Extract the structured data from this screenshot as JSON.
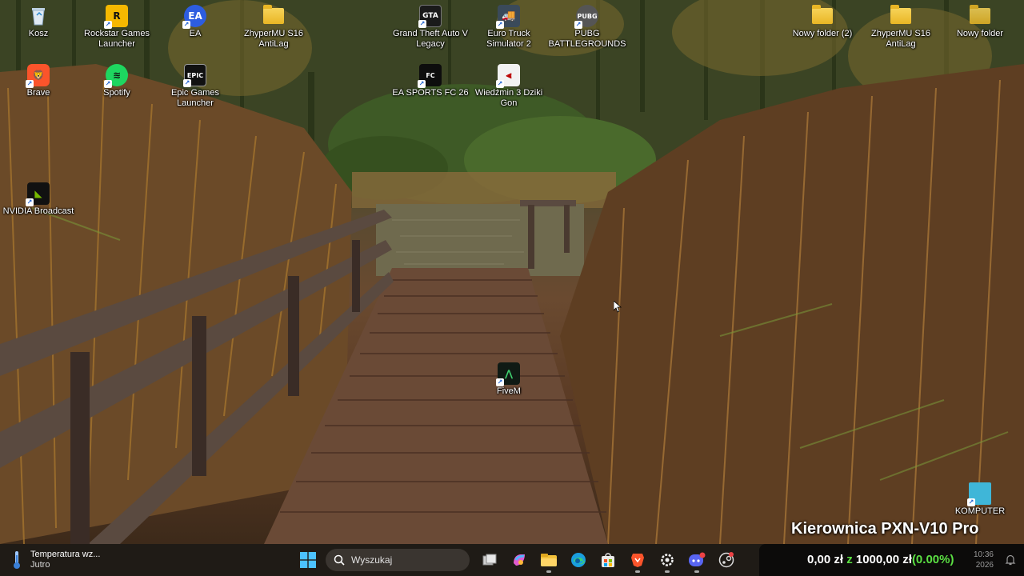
{
  "desktop": {
    "icons": [
      {
        "label": "Kosz",
        "icon": "recycle-bin-icon"
      },
      {
        "label": "Rockstar Games Launcher",
        "icon": "rockstar-icon"
      },
      {
        "label": "EA",
        "icon": "ea-icon"
      },
      {
        "label": "ZhyperMU S16 AntiLag",
        "icon": "folder-icon"
      },
      {
        "label": "Grand Theft Auto V Legacy",
        "icon": "gta-icon"
      },
      {
        "label": "Euro Truck Simulator 2",
        "icon": "truck-icon"
      },
      {
        "label": "PUBG BATTLEGROUNDS",
        "icon": "pubg-icon"
      },
      {
        "label": "Nowy folder (2)",
        "icon": "folder-icon"
      },
      {
        "label": "ZhyperMU S16 AntiLag",
        "icon": "folder-icon"
      },
      {
        "label": "Nowy folder",
        "icon": "folder-icon"
      },
      {
        "label": "Brave",
        "icon": "brave-icon"
      },
      {
        "label": "Spotify",
        "icon": "spotify-icon"
      },
      {
        "label": "Epic Games Launcher",
        "icon": "epic-icon"
      },
      {
        "label": "EA SPORTS FC 26",
        "icon": "fc26-icon"
      },
      {
        "label": "Wiedźmin 3 Dziki Gon",
        "icon": "witcher-icon"
      },
      {
        "label": "NVIDIA Broadcast",
        "icon": "nvidia-icon"
      },
      {
        "label": "FiveM",
        "icon": "fivem-icon"
      },
      {
        "label": "KOMPUTER",
        "icon": "computer-icon"
      }
    ]
  },
  "overlay": {
    "title": "Kierownica PXN-V10 Pro"
  },
  "taskbar": {
    "weather": {
      "title": "Temperatura wz...",
      "subtitle": "Jutro"
    },
    "search_placeholder": "Wyszukaj",
    "apps": [
      "task-view-icon",
      "copilot-icon",
      "file-explorer-icon",
      "edge-icon",
      "store-icon",
      "brave-icon",
      "settings-icon",
      "discord-icon",
      "steam-icon"
    ],
    "ticker": {
      "amount": "0,00 zł",
      "z_word": "z",
      "goal": "1000,00 zł",
      "percent": "(0.00%)"
    },
    "clock": {
      "time": "10:36",
      "date": "2026"
    }
  },
  "colors": {
    "accent_green": "#5be043",
    "taskbar_bg": "#1f1b16"
  }
}
